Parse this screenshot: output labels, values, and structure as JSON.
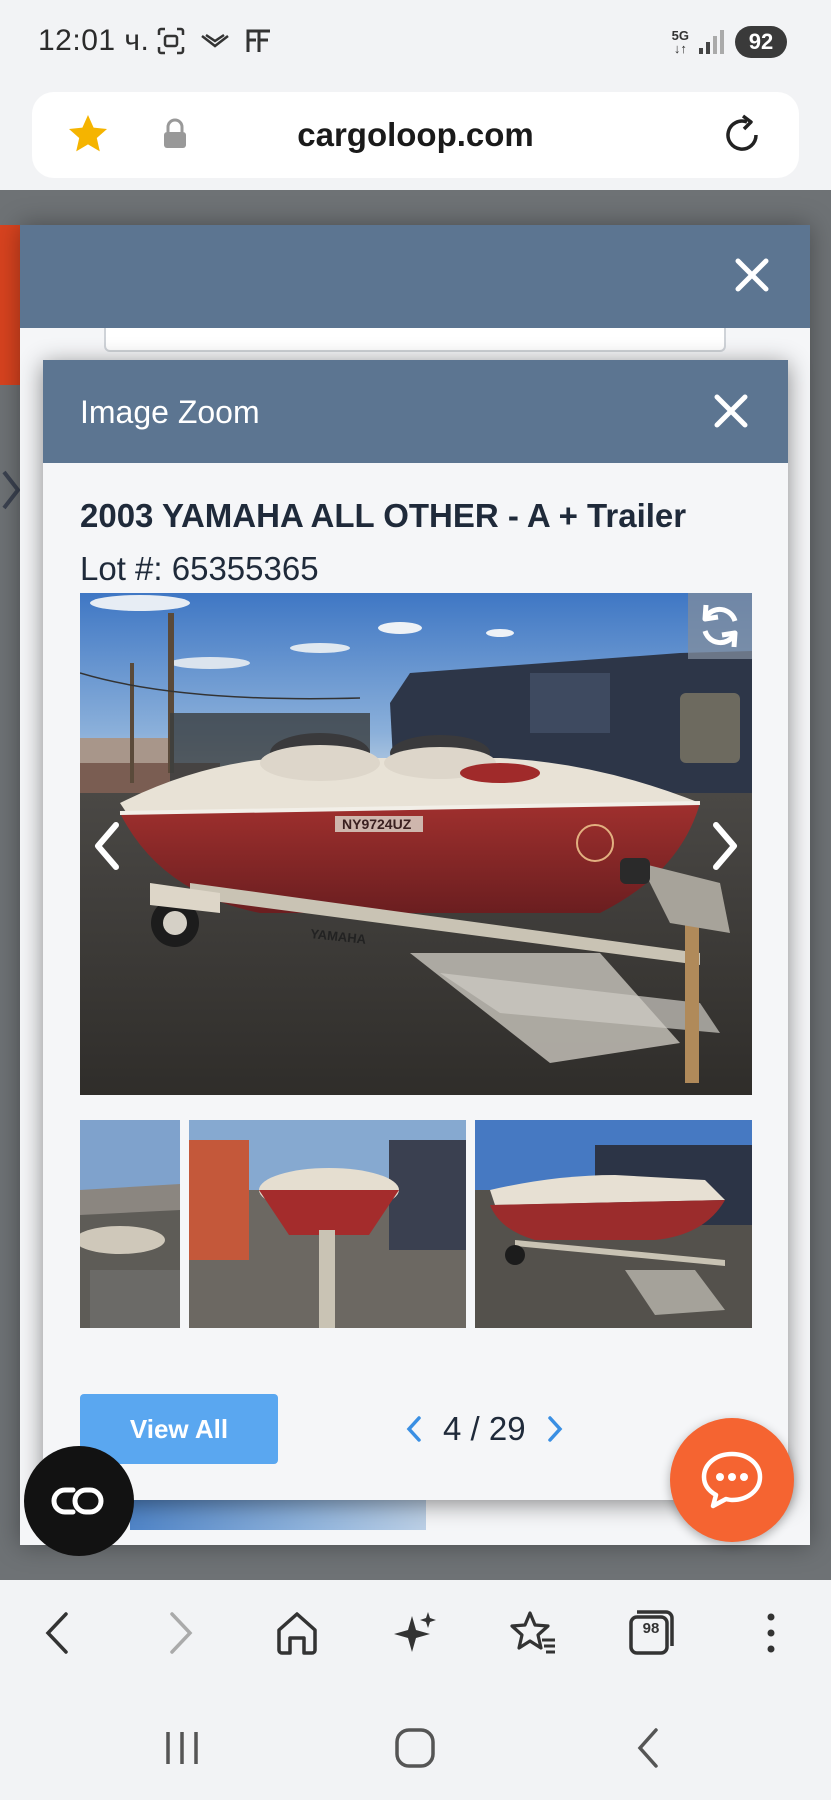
{
  "status_bar": {
    "time": "12:01 ч.",
    "network": "5G",
    "battery": "92",
    "icons": [
      "screenshot-icon",
      "app-icon",
      "ff-icon",
      "signal-icon"
    ]
  },
  "url_bar": {
    "url": "cargoloop.com",
    "icons": [
      "star-icon",
      "lock-icon",
      "reload-icon"
    ]
  },
  "outer_modal": {
    "icons": [
      "close-icon"
    ]
  },
  "image_zoom": {
    "title": "Image Zoom",
    "lot_title": "2003 YAMAHA ALL OTHER - A + Trailer",
    "lot_number": "Lot #: 65355365",
    "plate_text": "NY9724UZ",
    "trailer_brand": "YAMAHA",
    "view_all_label": "View All",
    "pager": "4 / 29",
    "current_image": 4,
    "total_images": 29,
    "icons": [
      "close-icon",
      "rotate-icon",
      "chevron-left-icon",
      "chevron-right-icon"
    ]
  },
  "floating": {
    "icons": [
      "cookie-settings-icon",
      "chat-icon"
    ]
  },
  "browser_toolbar": {
    "tabs_count": "98",
    "icons": [
      "back-icon",
      "forward-icon",
      "home-icon",
      "ai-sparkle-icon",
      "bookmarks-icon",
      "tabs-icon",
      "more-icon"
    ]
  },
  "nav_bar": {
    "icons": [
      "recents-icon",
      "home-nav-icon",
      "back-nav-icon"
    ]
  },
  "colors": {
    "header": "#5c7591",
    "accent_button": "#5aa7f0",
    "chat_button": "#f56431",
    "star": "#f5b400"
  }
}
